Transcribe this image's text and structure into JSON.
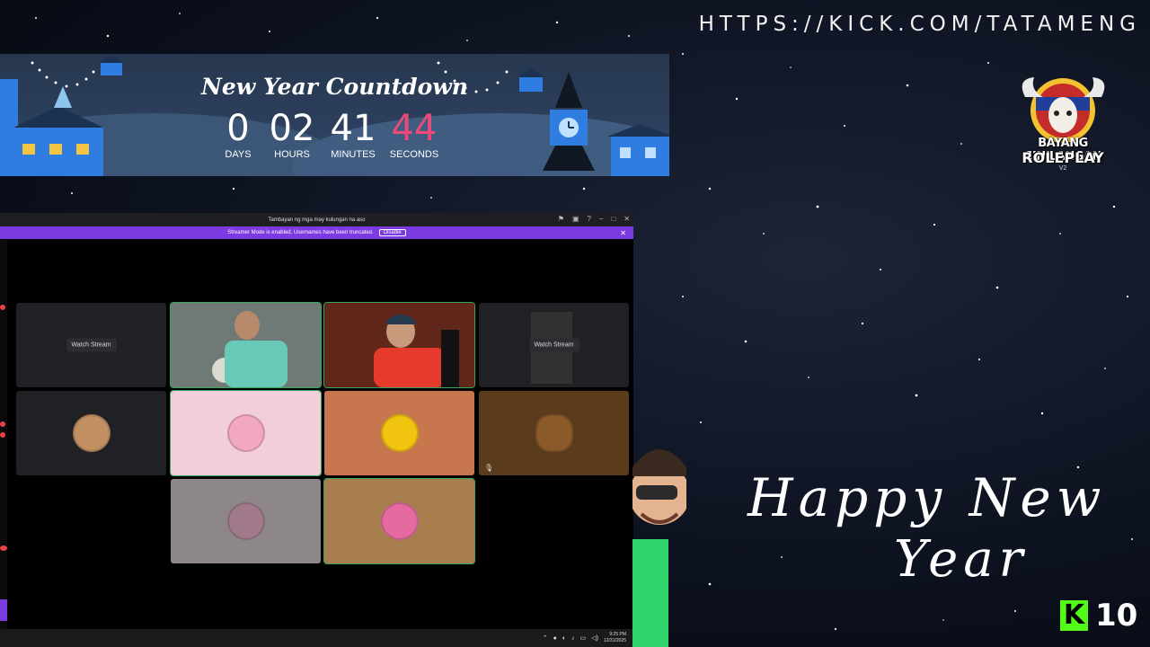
{
  "overlay": {
    "kick_url": "HTTPS://KICK.COM/TATAMENG",
    "logo_line1": "BAYANG SINILANGAN",
    "logo_line2": "ROLEPLAY",
    "logo_line3": "V2",
    "greeting_line1": "Happy New",
    "greeting_line2": "Year",
    "kick_badge_letter": "K",
    "kick_badge_count": "10"
  },
  "countdown": {
    "title": "New Year Countdown",
    "days": "0",
    "hours": "02",
    "minutes": "41",
    "seconds": "44",
    "days_label": "DAYS",
    "hours_label": "HOURS",
    "minutes_label": "MINUTES",
    "seconds_label": "SECONDS",
    "seconds_color": "#e84a7a"
  },
  "discord": {
    "window_title": "Tambayan ng mga may kulungan na aso",
    "streamer_banner": "Streamer Mode is enabled. Usernames have been truncated.",
    "disable_label": "Disable",
    "watch_stream_label_1": "Watch Stream",
    "watch_stream_label_2": "Watch Stream",
    "accent_color": "#7c3be0",
    "speaking_color": "#3ba55d"
  },
  "taskbar": {
    "time": "9:25 PM",
    "date": "12/31/2025"
  }
}
